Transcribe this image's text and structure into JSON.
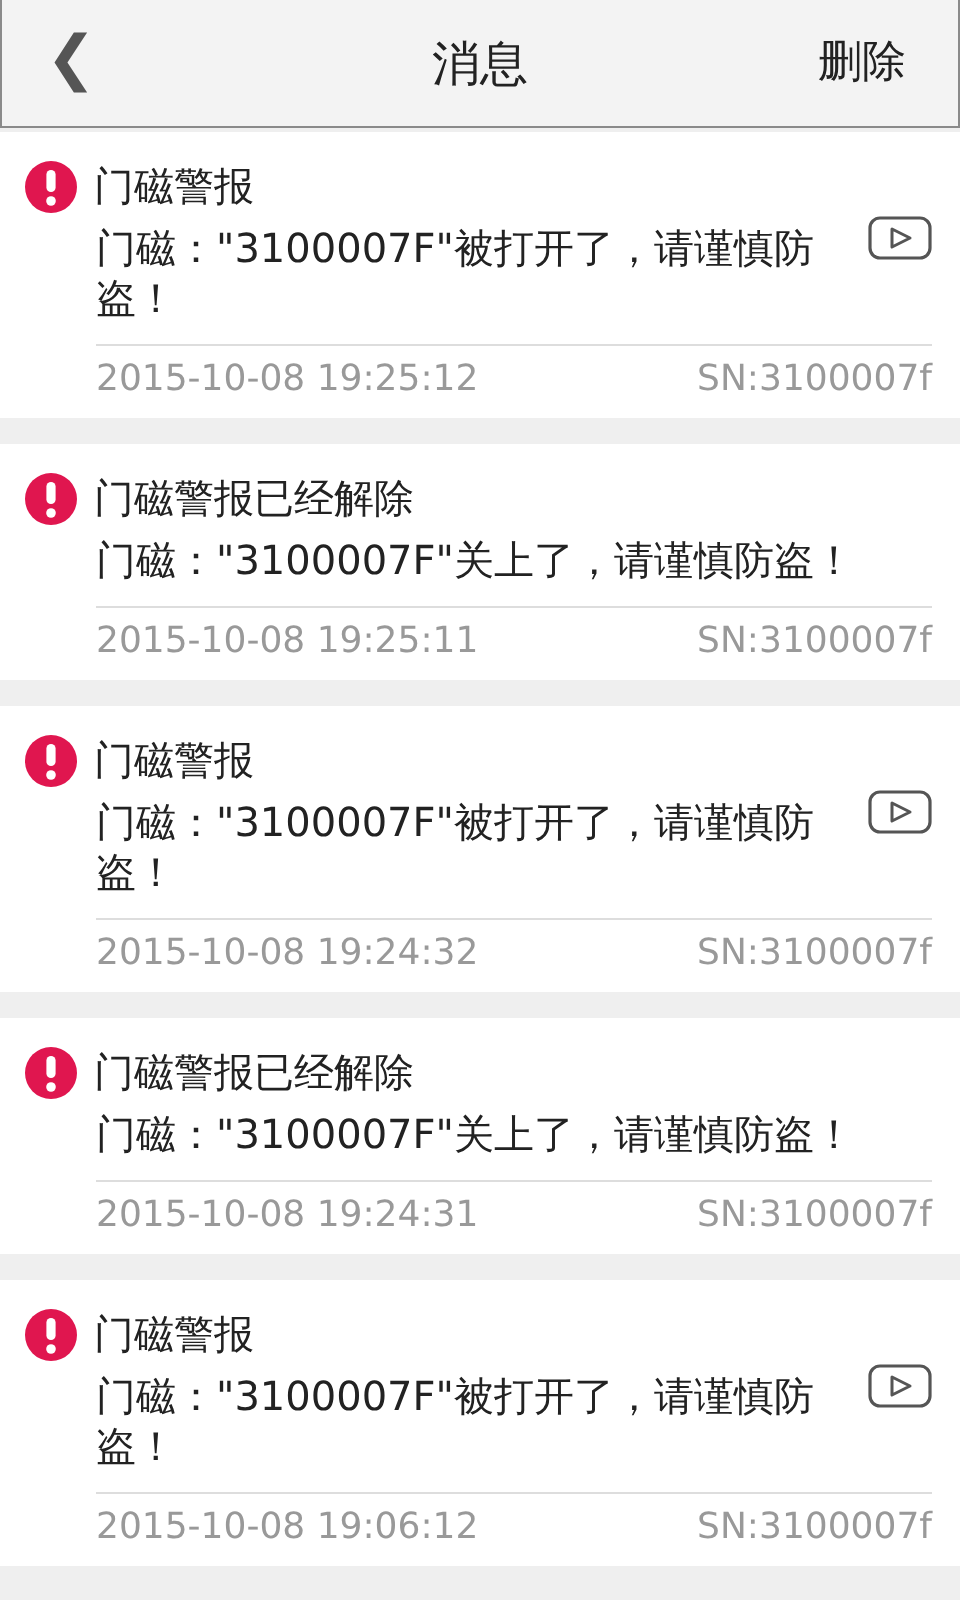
{
  "header": {
    "back_icon": "❮",
    "title": "消息",
    "action": "删除"
  },
  "messages": [
    {
      "title": "门磁警报",
      "text": "门磁：\"3100007F\"被打开了，请谨慎防盗！",
      "has_video": true,
      "time": "2015-10-08 19:25:12",
      "sn": "SN:3100007f"
    },
    {
      "title": "门磁警报已经解除",
      "text": "门磁：\"3100007F\"关上了，请谨慎防盗！",
      "has_video": false,
      "time": "2015-10-08 19:25:11",
      "sn": "SN:3100007f"
    },
    {
      "title": "门磁警报",
      "text": "门磁：\"3100007F\"被打开了，请谨慎防盗！",
      "has_video": true,
      "time": "2015-10-08 19:24:32",
      "sn": "SN:3100007f"
    },
    {
      "title": "门磁警报已经解除",
      "text": "门磁：\"3100007F\"关上了，请谨慎防盗！",
      "has_video": false,
      "time": "2015-10-08 19:24:31",
      "sn": "SN:3100007f"
    },
    {
      "title": "门磁警报",
      "text": "门磁：\"3100007F\"被打开了，请谨慎防盗！",
      "has_video": true,
      "time": "2015-10-08 19:06:12",
      "sn": "SN:3100007f"
    }
  ]
}
